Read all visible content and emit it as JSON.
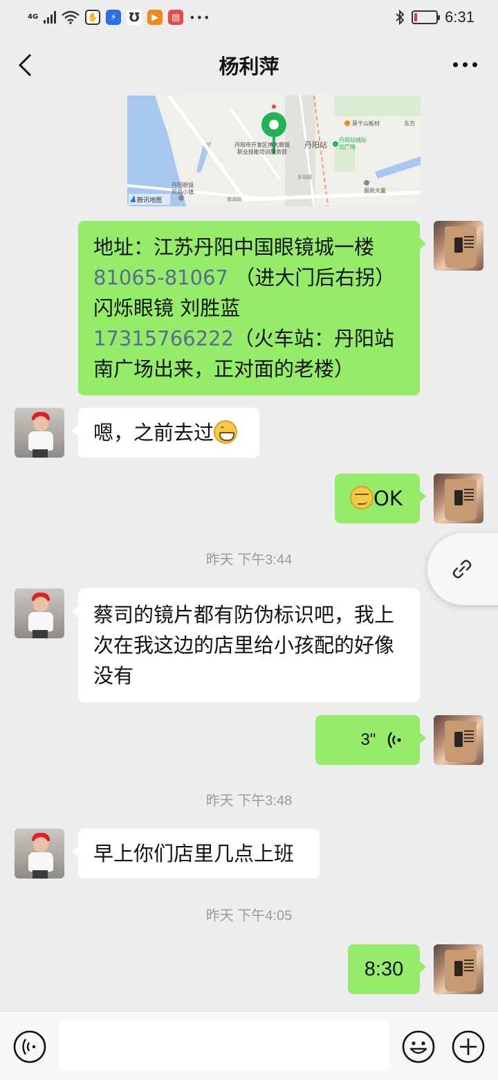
{
  "status_bar": {
    "network": "4G",
    "time": "6:31"
  },
  "header": {
    "title": "杨利萍"
  },
  "map": {
    "labels": {
      "station": "丹阳站",
      "poi1": "丹阳市开发区博大眼镜",
      "poi1b": "职业技能培训服务部",
      "north_square": "丹阳站城际",
      "north_square_b": "北广场",
      "building": "莫干山板材",
      "east": "东方",
      "lake": "丹阳眼镜",
      "lake_b": "风尚小镇",
      "mansion": "丽苑大厦",
      "road1": "南湖路",
      "road2": "东站路",
      "provider": "腾讯地图"
    }
  },
  "messages": [
    {
      "type": "text",
      "from": "me",
      "lines": [
        {
          "parts": [
            {
              "text": "地址：江苏丹阳中国眼镜城一楼"
            }
          ]
        },
        {
          "parts": [
            {
              "text": "81065-81067",
              "link": true
            },
            {
              "text": " （进大门后右拐）"
            }
          ]
        },
        {
          "parts": [
            {
              "text": "闪烁眼镜 刘胜蓝"
            }
          ]
        },
        {
          "parts": [
            {
              "text": "17315766222",
              "link": true
            },
            {
              "text": "（火车站：丹阳站"
            }
          ]
        },
        {
          "parts": [
            {
              "text": "南广场出来，正对面的老楼）"
            }
          ]
        }
      ]
    },
    {
      "type": "text",
      "from": "them",
      "text": "嗯，之前去过",
      "emoji": "grin-emoji"
    },
    {
      "type": "text",
      "from": "me",
      "text": "OK",
      "emoji": "smirk-emoji"
    },
    {
      "type": "time",
      "text": "昨天 下午3:44"
    },
    {
      "type": "text",
      "from": "them",
      "lines": [
        "蔡司的镜片都有防伪标识吧，我上",
        "次在我这边的店里给小孩配的好像",
        "没有"
      ]
    },
    {
      "type": "voice",
      "from": "me",
      "duration": "3\""
    },
    {
      "type": "time",
      "text": "昨天 下午3:48"
    },
    {
      "type": "text",
      "from": "them",
      "text": "早上你们店里几点上班"
    },
    {
      "type": "time",
      "text": "昨天 下午4:05"
    },
    {
      "type": "text",
      "from": "me",
      "text": "8:30"
    }
  ],
  "input_bar": {
    "value": ""
  },
  "colors": {
    "me_bubble": "#95ec69",
    "them_bubble": "#ffffff",
    "link": "#576b95",
    "background": "#ededed"
  },
  "icons": [
    "back-icon",
    "more-icon",
    "link-icon",
    "voice-icon",
    "emoji-icon",
    "plus-icon",
    "bluetooth-icon",
    "battery-icon",
    "wifi-icon"
  ]
}
